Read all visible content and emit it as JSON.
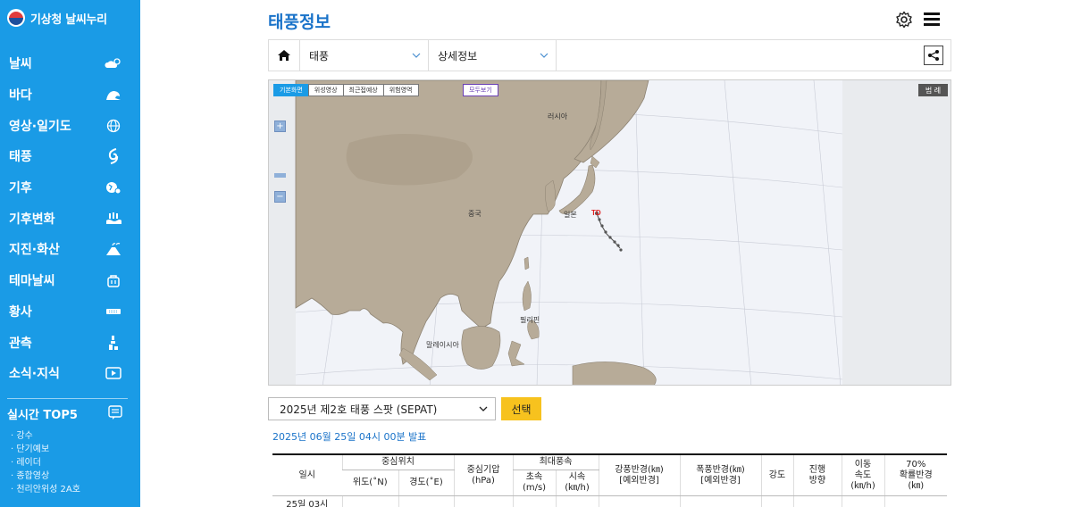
{
  "brand": {
    "name": "기상청 날씨누리"
  },
  "nav": [
    {
      "label": "날씨",
      "icon": "cloud-sun-icon"
    },
    {
      "label": "바다",
      "icon": "wave-icon"
    },
    {
      "label": "영상·일기도",
      "icon": "globe-icon"
    },
    {
      "label": "태풍",
      "icon": "typhoon-icon"
    },
    {
      "label": "기후",
      "icon": "climate-icon"
    },
    {
      "label": "기후변화",
      "icon": "thermometer-water-icon"
    },
    {
      "label": "지진·화산",
      "icon": "volcano-icon"
    },
    {
      "label": "테마날씨",
      "icon": "bag-icon"
    },
    {
      "label": "황사",
      "icon": "dust-icon"
    },
    {
      "label": "관측",
      "icon": "observation-icon"
    },
    {
      "label": "소식·지식",
      "icon": "play-icon"
    }
  ],
  "top5": {
    "title": "실시간 TOP5",
    "items": [
      "강수",
      "단기예보",
      "레이더",
      "종합영상",
      "천리안위성 2A호"
    ]
  },
  "page": {
    "title": "태풍정보"
  },
  "toolbar": {
    "menu1": "태풍",
    "menu2": "상세정보"
  },
  "map": {
    "tabs": [
      "기본화면",
      "위성영상",
      "최근접예상",
      "위험영역"
    ],
    "all_label": "모두보기",
    "legend_label": "범 례",
    "zoom_in": "+",
    "zoom_out": "−",
    "labels": {
      "russia": "러시아",
      "china": "중국",
      "japan": "일본",
      "philippines": "필리핀",
      "malaysia": "말레이시아",
      "td": "TD"
    }
  },
  "typhoon_select": {
    "value": "2025년 제2호 태풍 스팟 (SEPAT)",
    "button": "선택"
  },
  "announce": "2025년 06월 25일 04시 00분 발표",
  "table": {
    "h_time": "일시",
    "h_center": "중심위치",
    "h_lat": "위도(˚N)",
    "h_lon": "경도(˚E)",
    "h_pressure": "중심기압\n(hPa)",
    "h_maxwind": "최대풍속",
    "h_ms": "초속\n(m/s)",
    "h_kmh": "시속\n(㎞/h)",
    "h_strong": "강풍반경(㎞)\n[예외반경]",
    "h_storm": "폭풍반경(㎞)\n[예외반경]",
    "h_intensity": "강도",
    "h_dir": "진행\n방향",
    "h_speed": "이동\n속도\n(㎞/h)",
    "h_prob": "70%\n확률반경\n(㎞)",
    "first_row_time": "25일 03시"
  },
  "colors": {
    "sidebar": "#1a9be6",
    "title": "#1a73c9",
    "button": "#f7c21e"
  }
}
